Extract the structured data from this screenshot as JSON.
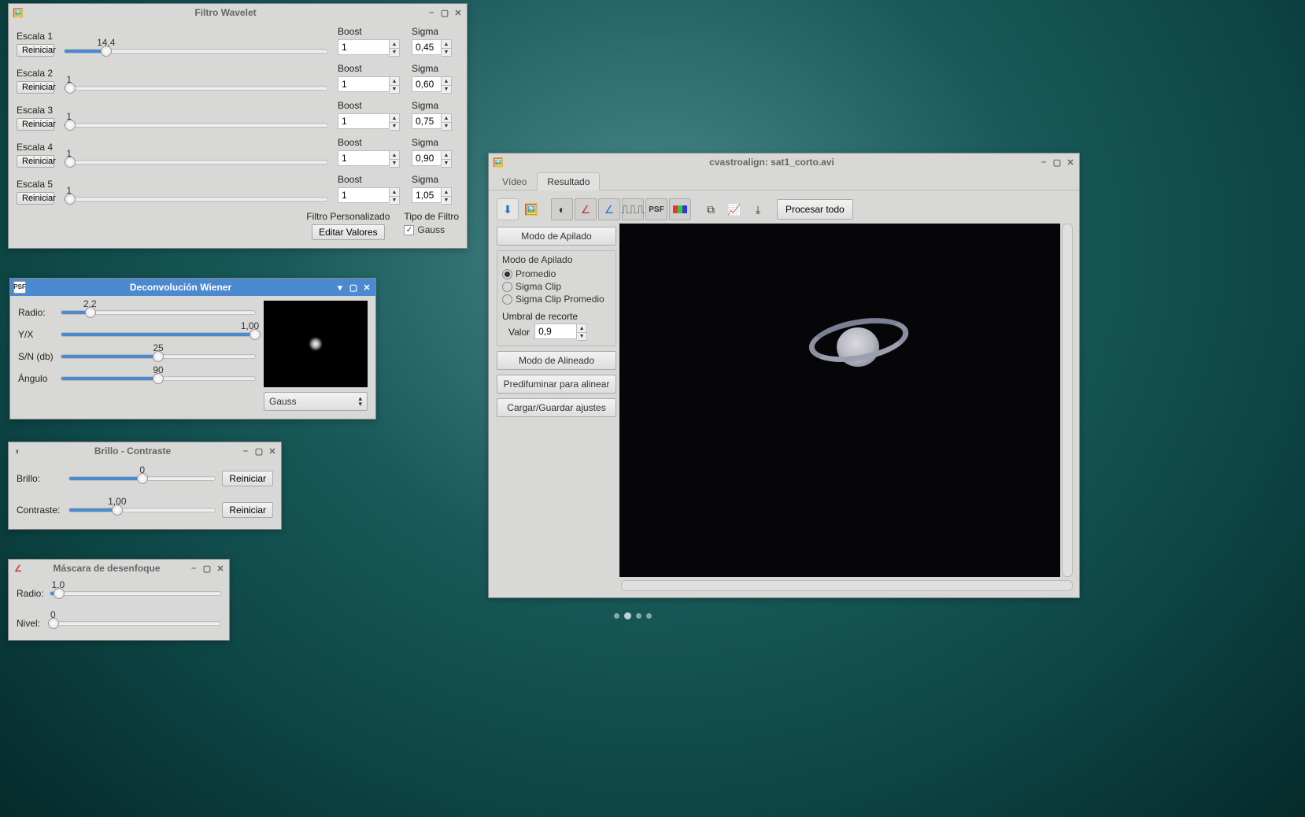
{
  "wavelet": {
    "title": "Filtro Wavelet",
    "reset_label": "Reiniciar",
    "boost_label": "Boost",
    "sigma_label": "Sigma",
    "filter_custom_label": "Filtro Personalizado",
    "edit_values_label": "Editar Valores",
    "filter_type_label": "Tipo de Filtro",
    "gauss_label": "Gauss",
    "scales": [
      {
        "label": "Escala 1",
        "value": "14,4",
        "pct": 16,
        "boost": "1",
        "sigma": "0,45"
      },
      {
        "label": "Escala 2",
        "value": "1",
        "pct": 2,
        "boost": "1",
        "sigma": "0,60"
      },
      {
        "label": "Escala 3",
        "value": "1",
        "pct": 2,
        "boost": "1",
        "sigma": "0,75"
      },
      {
        "label": "Escala 4",
        "value": "1",
        "pct": 2,
        "boost": "1",
        "sigma": "0,90"
      },
      {
        "label": "Escala 5",
        "value": "1",
        "pct": 2,
        "boost": "1",
        "sigma": "1,05"
      }
    ]
  },
  "psf": {
    "icon": "PSF",
    "title": "Deconvolución Wiener",
    "rows": [
      {
        "label": "Radio:",
        "value": "2,2",
        "pct": 15
      },
      {
        "label": "Y/X",
        "value": "1,00",
        "pct": 100
      },
      {
        "label": "S/N (db)",
        "value": "25",
        "pct": 50
      },
      {
        "label": "Ángulo",
        "value": "90",
        "pct": 50
      }
    ],
    "method": "Gauss"
  },
  "bc": {
    "title": "Brillo - Contraste",
    "brightness_label": "Brillo:",
    "contrast_label": "Contraste:",
    "reset_label": "Reiniciar",
    "brightness_value": "0",
    "brightness_pct": 50,
    "contrast_value": "1,00",
    "contrast_pct": 33
  },
  "unsharp": {
    "title": "Máscara de desenfoque",
    "radius_label": "Radio:",
    "level_label": "Nivel:",
    "radius_value": "1,0",
    "radius_pct": 5,
    "level_value": "0",
    "level_pct": 2
  },
  "main": {
    "title": "cvastroalign: sat1_corto.avi",
    "tabs": {
      "video": "Vídeo",
      "result": "Resultado"
    },
    "toolbar": {
      "process_all": "Procesar todo",
      "psf_label": "PSF"
    },
    "stack_mode_btn": "Modo de Apilado",
    "stack_group_title": "Modo de Apilado",
    "stack_opts": {
      "avg": "Promedio",
      "sigma": "Sigma Clip",
      "sigmaavg": "Sigma Clip Promedio"
    },
    "clip_threshold": "Umbral de recorte",
    "value_label": "Valor",
    "clip_value": "0,9",
    "align_mode_btn": "Modo de Alineado",
    "preblur_btn": "Predifuminar para alinear",
    "loadsave_btn": "Cargar/Guardar ajustes"
  }
}
